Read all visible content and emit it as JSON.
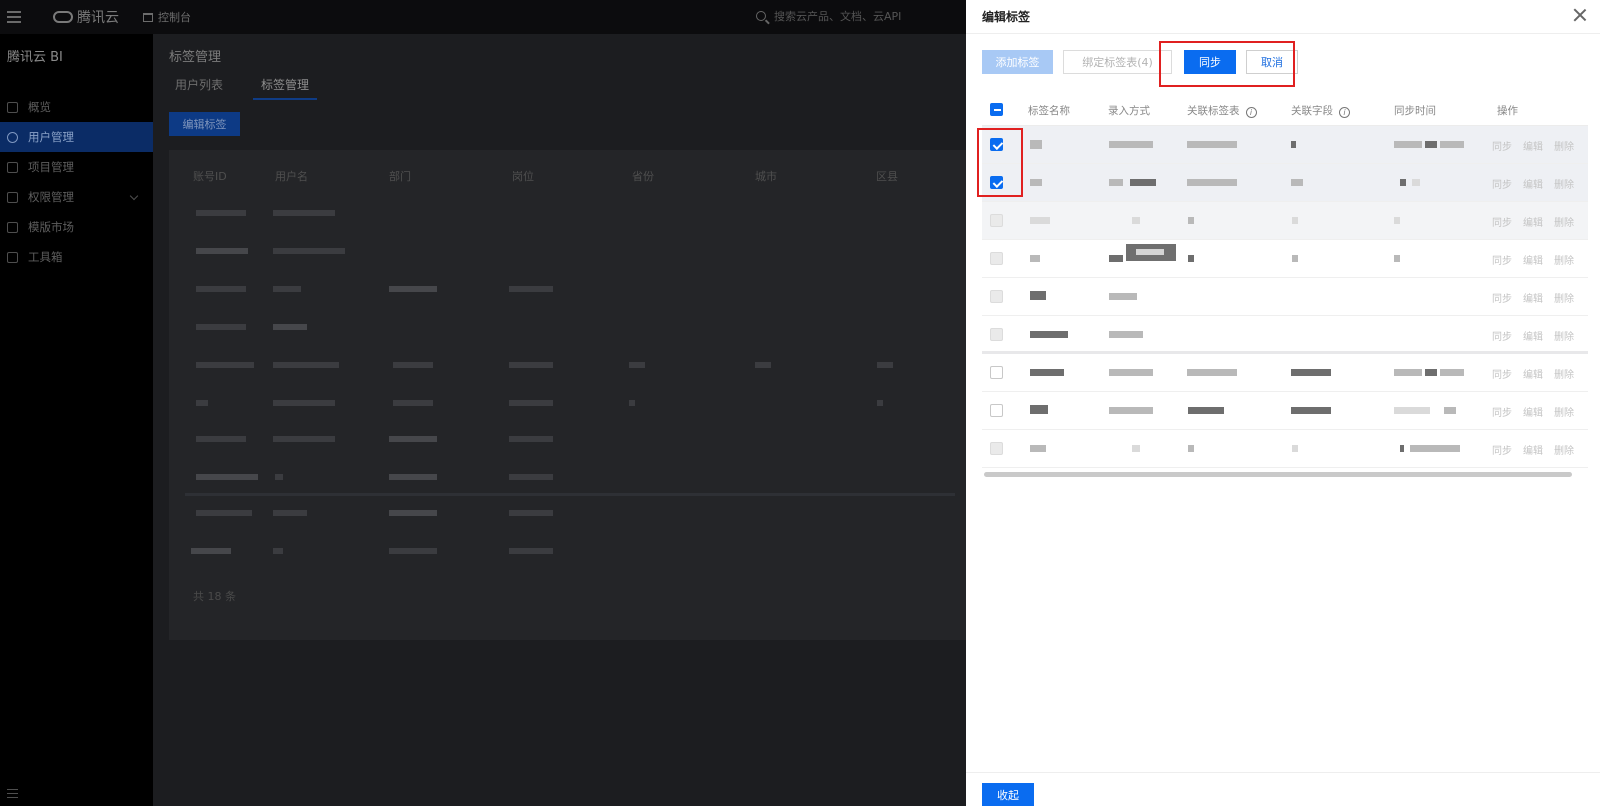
{
  "topbar": {
    "logo_text": "腾讯云",
    "console_label": "控制台",
    "search_placeholder": "搜索云产品、文档、云API"
  },
  "sidebar": {
    "brand": "腾讯云 BI",
    "items": [
      {
        "label": "概览"
      },
      {
        "label": "用户管理"
      },
      {
        "label": "项目管理"
      },
      {
        "label": "权限管理"
      },
      {
        "label": "模版市场"
      },
      {
        "label": "工具箱"
      }
    ]
  },
  "main": {
    "title": "标签管理",
    "tabs": [
      {
        "label": "用户列表"
      },
      {
        "label": "标签管理"
      }
    ],
    "edit_button": "编辑标签",
    "columns": [
      "账号ID",
      "用户名",
      "部门",
      "岗位",
      "省份",
      "城市",
      "区县"
    ],
    "total": "共 18 条"
  },
  "drawer": {
    "title": "编辑标签",
    "toolbar": {
      "add_label": "添加标签",
      "bind_label": "绑定标签表(4)",
      "sync_label": "同步",
      "cancel_label": "取消"
    },
    "columns": [
      "标签名称",
      "录入方式",
      "关联标签表",
      "关联字段",
      "同步时间",
      "操作"
    ],
    "row_ops": [
      "同步",
      "编辑",
      "删除"
    ],
    "collapse_label": "收起"
  }
}
